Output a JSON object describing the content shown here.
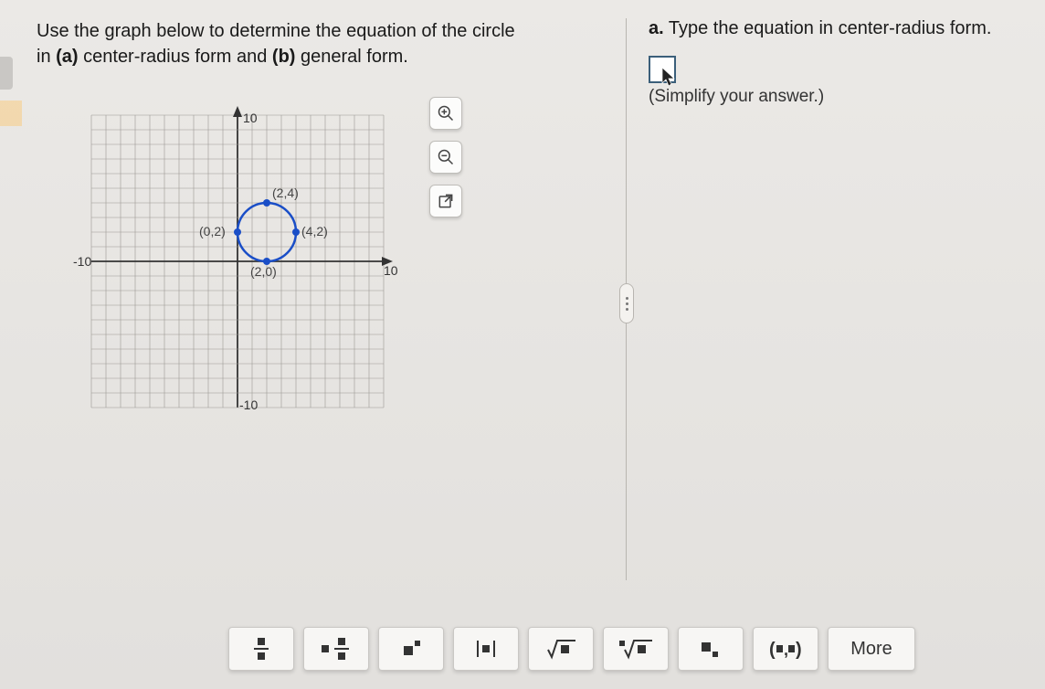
{
  "question": {
    "line1": "Use the graph below to determine the equation of the circle",
    "line2_pre": "in ",
    "line2_a": "(a)",
    "line2_mid": " center-radius form and ",
    "line2_b": "(b)",
    "line2_post": " general form."
  },
  "graph": {
    "x_min": -10,
    "x_max": 10,
    "y_min": -10,
    "y_max": 10,
    "x_min_lbl": "-10",
    "x_max_lbl": "10",
    "y_min_lbl": "-10",
    "y_max_lbl": "10",
    "points": [
      {
        "x": 2,
        "y": 4,
        "label": "(2,4)"
      },
      {
        "x": 0,
        "y": 2,
        "label": "(0,2)"
      },
      {
        "x": 4,
        "y": 2,
        "label": "(4,2)"
      },
      {
        "x": 2,
        "y": 0,
        "label": "(2,0)"
      }
    ],
    "circle": {
      "cx": 2,
      "cy": 2,
      "r": 2
    }
  },
  "part_a": {
    "prefix": "a.",
    "text": " Type the equation in center-radius form.",
    "hint": "(Simplify your answer.)"
  },
  "tools": {
    "zoom_in": "zoom-in",
    "zoom_out": "zoom-out",
    "popout": "popout"
  },
  "toolbar": {
    "items": [
      {
        "name": "fraction",
        "glyph": "frac"
      },
      {
        "name": "mixed-fraction",
        "glyph": "mixedfrac"
      },
      {
        "name": "exponent",
        "glyph": "exp"
      },
      {
        "name": "absolute-value",
        "glyph": "abs"
      },
      {
        "name": "square-root",
        "glyph": "sqrt"
      },
      {
        "name": "nth-root",
        "glyph": "nroot"
      },
      {
        "name": "subscript",
        "glyph": "sub"
      },
      {
        "name": "ordered-pair",
        "glyph": "pair"
      },
      {
        "name": "more",
        "glyph": "more",
        "label": "More"
      }
    ]
  },
  "chart_data": {
    "type": "scatter",
    "title": "",
    "xlabel": "",
    "ylabel": "",
    "xlim": [
      -10,
      10
    ],
    "ylim": [
      -10,
      10
    ],
    "series": [
      {
        "name": "circle-points",
        "x": [
          2,
          0,
          4,
          2
        ],
        "y": [
          4,
          2,
          2,
          0
        ]
      }
    ],
    "annotations": [
      "(2,4)",
      "(0,2)",
      "(4,2)",
      "(2,0)"
    ],
    "circle": {
      "center": [
        2,
        2
      ],
      "radius": 2
    }
  }
}
